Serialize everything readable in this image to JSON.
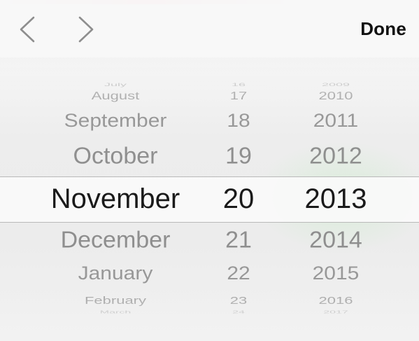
{
  "toolbar": {
    "prev_icon": "chevron-left-icon",
    "next_icon": "chevron-right-icon",
    "done_label": "Done",
    "accent_color": "#111111"
  },
  "picker": {
    "months": [
      "July",
      "August",
      "September",
      "October",
      "November",
      "December",
      "January",
      "February",
      "March"
    ],
    "days": [
      "16",
      "17",
      "18",
      "19",
      "20",
      "21",
      "22",
      "23",
      "24"
    ],
    "years": [
      "2009",
      "2010",
      "2011",
      "2012",
      "2013",
      "2014",
      "2015",
      "2016",
      "2017"
    ],
    "selected": {
      "month": "November",
      "day": "20",
      "year": "2013"
    },
    "selected_index": 4
  }
}
